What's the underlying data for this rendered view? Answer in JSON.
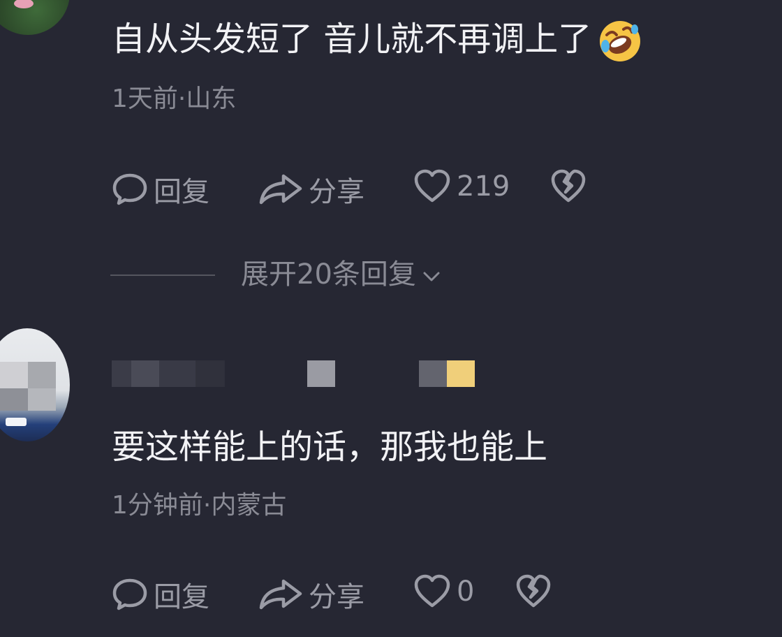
{
  "comments": [
    {
      "text": "自从头发短了 音儿就不再调上了",
      "emoji": "rofl-emoji",
      "meta": "1天前·山东",
      "actions": {
        "reply": "回复",
        "share": "分享",
        "likes": "219"
      }
    },
    {
      "username": "",
      "text": "要这样能上的话，那我也能上",
      "meta": "1分钟前·内蒙古",
      "actions": {
        "reply": "回复",
        "share": "分享",
        "likes": "0"
      }
    }
  ],
  "expand_replies": "展开20条回复",
  "colors": {
    "background": "#262733",
    "text": "#f2f2f5",
    "secondary": "#8a8b95",
    "icon": "#9b9ca6"
  }
}
